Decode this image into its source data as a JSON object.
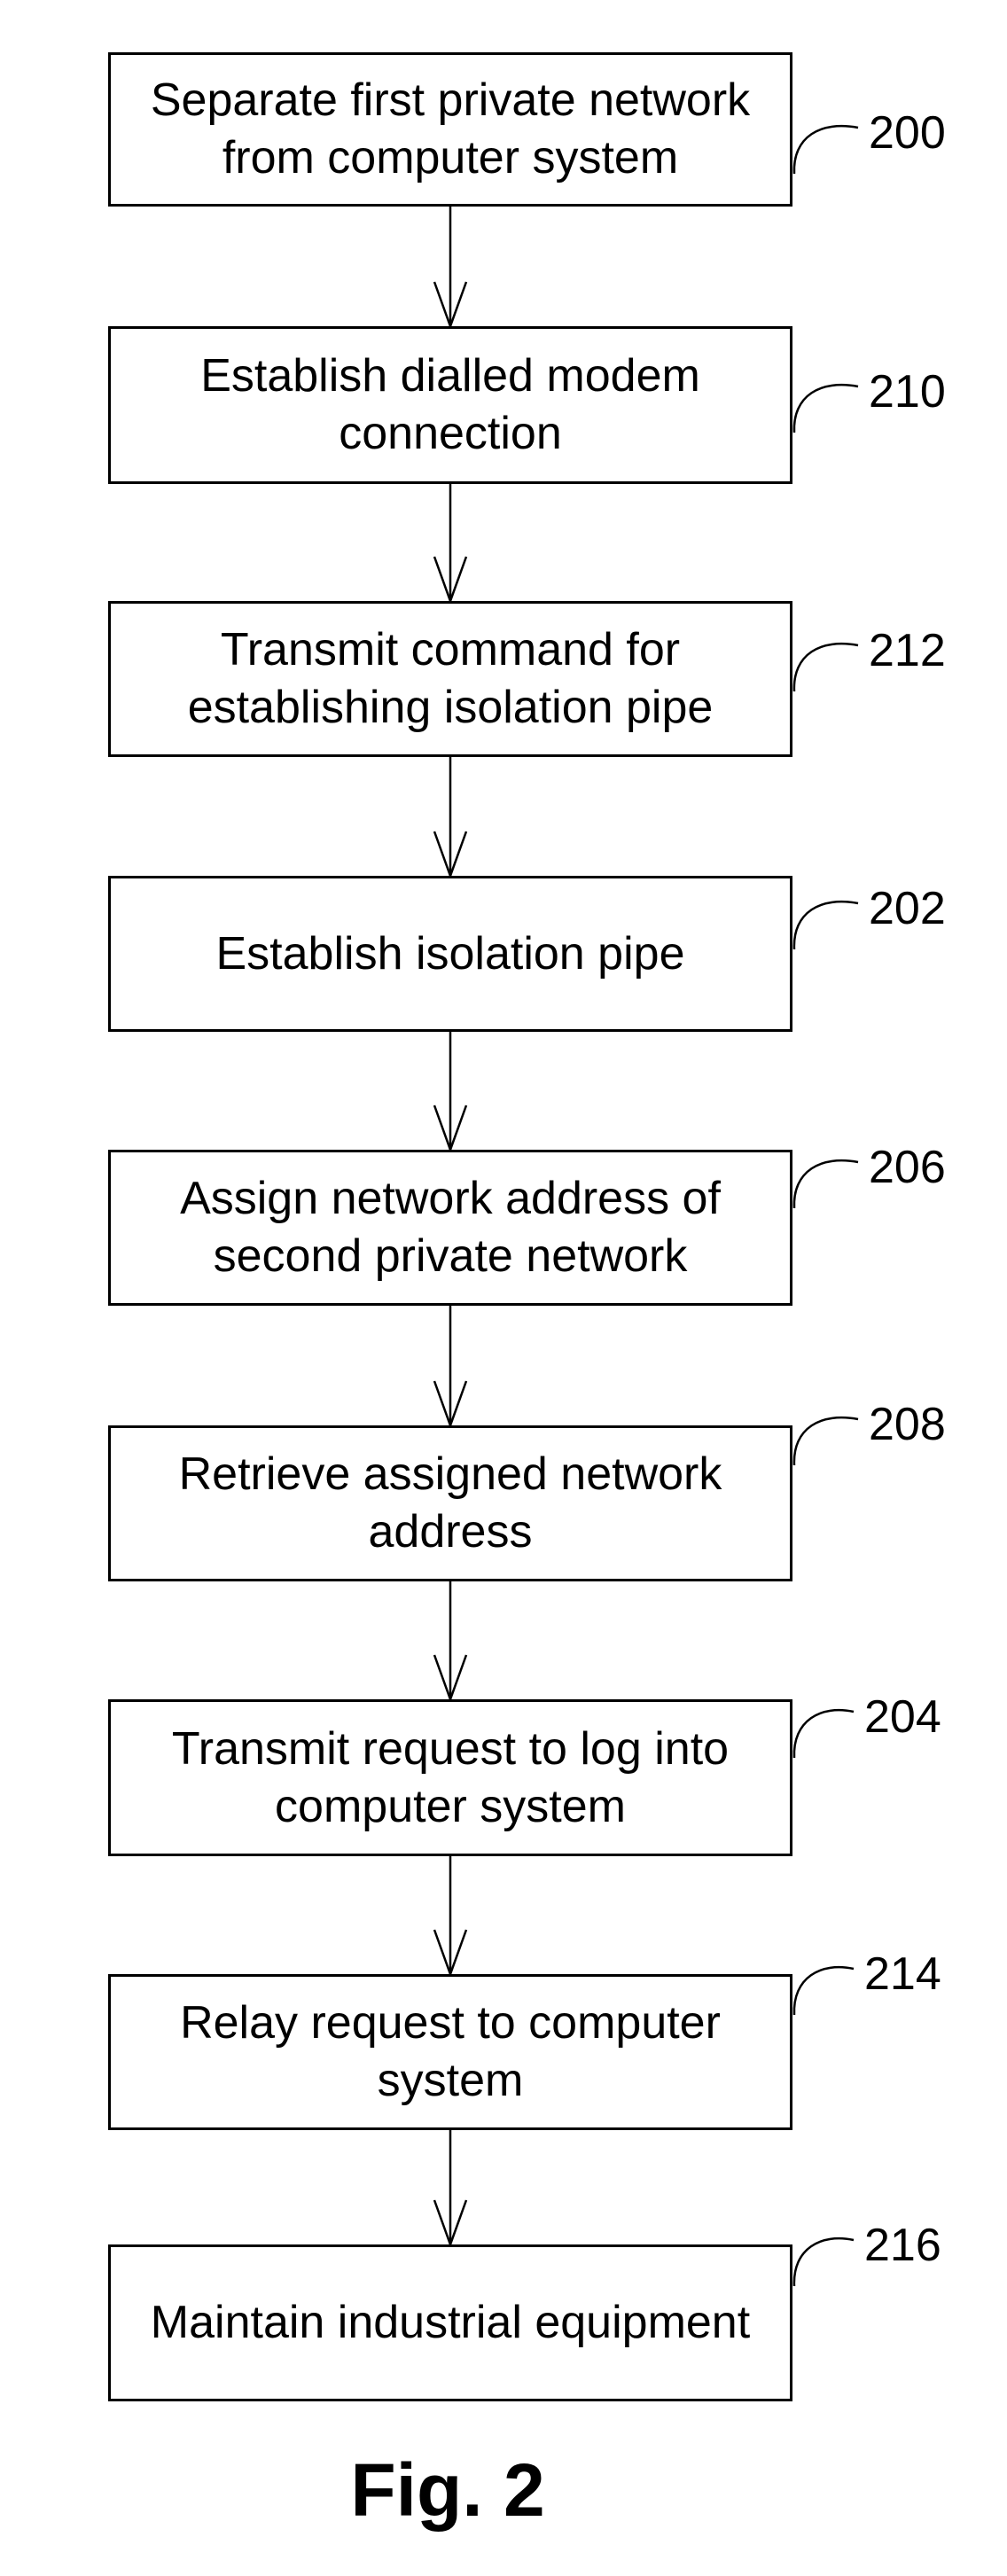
{
  "figure": {
    "caption": "Fig. 2",
    "steps": [
      {
        "ref": "200",
        "text": "Separate first private network\nfrom computer system"
      },
      {
        "ref": "210",
        "text": "Establish  dialled modem\nconnection"
      },
      {
        "ref": "212",
        "text": "Transmit command for\nestablishing isolation pipe"
      },
      {
        "ref": "202",
        "text": "Establish isolation pipe"
      },
      {
        "ref": "206",
        "text": "Assign network address of\nsecond private network"
      },
      {
        "ref": "208",
        "text": "Retrieve assigned network\naddress"
      },
      {
        "ref": "204",
        "text": "Transmit request to log into\ncomputer system"
      },
      {
        "ref": "214",
        "text": "Relay request to computer\nsystem"
      },
      {
        "ref": "216",
        "text": "Maintain industrial equipment"
      }
    ]
  }
}
